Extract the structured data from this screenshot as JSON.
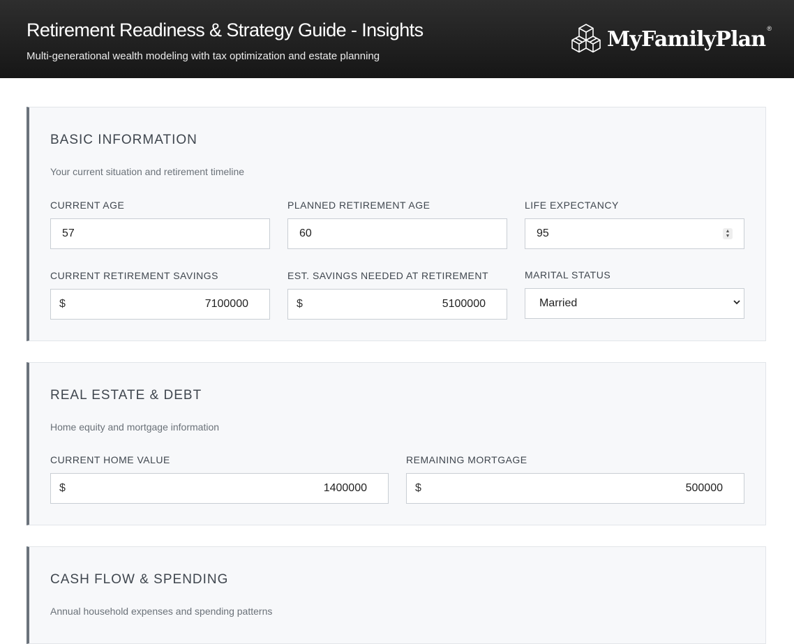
{
  "header": {
    "title": "Retirement Readiness & Strategy Guide - Insights",
    "subtitle": "Multi-generational wealth modeling with tax optimization and estate planning",
    "logo_text": "MyFamilyPlan",
    "logo_mark": "®"
  },
  "sections": {
    "basic": {
      "title": "BASIC INFORMATION",
      "desc": "Your current situation and retirement timeline",
      "current_age": {
        "label": "CURRENT AGE",
        "value": "57"
      },
      "retirement_age": {
        "label": "PLANNED RETIREMENT AGE",
        "value": "60"
      },
      "life_expectancy": {
        "label": "LIFE EXPECTANCY",
        "value": "95"
      },
      "savings": {
        "label": "CURRENT RETIREMENT SAVINGS",
        "prefix": "$",
        "value": "7100000"
      },
      "needed": {
        "label": "EST. SAVINGS NEEDED AT RETIREMENT",
        "prefix": "$",
        "value": "5100000"
      },
      "marital": {
        "label": "MARITAL STATUS",
        "value": "Married"
      }
    },
    "real_estate": {
      "title": "REAL ESTATE & DEBT",
      "desc": "Home equity and mortgage information",
      "home_value": {
        "label": "CURRENT HOME VALUE",
        "prefix": "$",
        "value": "1400000"
      },
      "mortgage": {
        "label": "REMAINING MORTGAGE",
        "prefix": "$",
        "value": "500000"
      }
    },
    "cash_flow": {
      "title": "CASH FLOW & SPENDING",
      "desc": "Annual household expenses and spending patterns"
    }
  },
  "icons": {
    "logo": "cube-lattice-icon",
    "spinner": "number-spinner-icon",
    "select": "chevron-down-icon"
  }
}
